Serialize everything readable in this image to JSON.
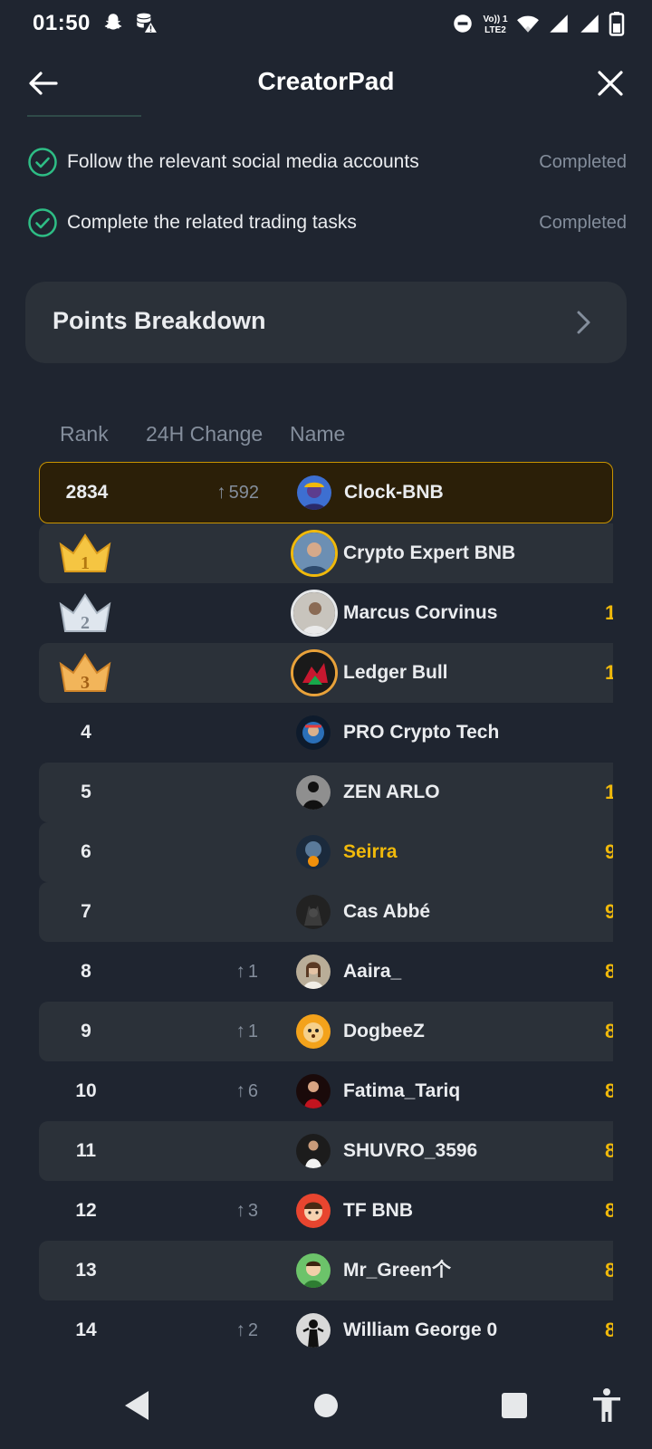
{
  "status_bar": {
    "time": "01:50",
    "icons": [
      "snapchat-icon",
      "storage-warning-icon",
      "do-not-disturb-icon",
      "volte-icon",
      "wifi-icon",
      "signal-icon",
      "signal-icon",
      "battery-icon"
    ],
    "volte_text": "Vo)) 1 LTE2"
  },
  "header": {
    "title": "CreatorPad",
    "back_icon": "back-arrow-icon",
    "close_icon": "close-icon"
  },
  "tasks": [
    {
      "label": "Follow the relevant social media accounts",
      "status": "Completed",
      "icon": "check-circle-icon"
    },
    {
      "label": "Complete the related trading tasks",
      "status": "Completed",
      "icon": "check-circle-icon"
    }
  ],
  "points_breakdown": {
    "title": "Points Breakdown",
    "icon": "chevron-right-icon"
  },
  "leaderboard": {
    "columns": {
      "rank": "Rank",
      "change": "24H Change",
      "name": "Name"
    },
    "rows": [
      {
        "rank": "2834",
        "change": "592",
        "name": "Clock-BNB",
        "points_peek": ""
      },
      {
        "rank": "1",
        "change": "",
        "name": "Crypto Expert BNB",
        "points_peek": ""
      },
      {
        "rank": "2",
        "change": "",
        "name": "Marcus Corvinus",
        "points_peek": "1"
      },
      {
        "rank": "3",
        "change": "",
        "name": "Ledger Bull",
        "points_peek": "1"
      },
      {
        "rank": "4",
        "change": "",
        "name": "PRO Crypto Tech",
        "points_peek": ""
      },
      {
        "rank": "5",
        "change": "",
        "name": "ZEN ARLO",
        "points_peek": "1"
      },
      {
        "rank": "6",
        "change": "",
        "name": "Seirra",
        "points_peek": "9"
      },
      {
        "rank": "7",
        "change": "",
        "name": "Cas Abbé",
        "points_peek": "9"
      },
      {
        "rank": "8",
        "change": "1",
        "name": "Aaira_",
        "points_peek": "8"
      },
      {
        "rank": "9",
        "change": "1",
        "name": "DogbeeZ",
        "points_peek": "8"
      },
      {
        "rank": "10",
        "change": "6",
        "name": "Fatima_Tariq",
        "points_peek": "8"
      },
      {
        "rank": "11",
        "change": "",
        "name": "SHUVRO_3596",
        "points_peek": "8"
      },
      {
        "rank": "12",
        "change": "3",
        "name": "TF BNB",
        "points_peek": "8"
      },
      {
        "rank": "13",
        "change": "",
        "name": "Mr_Green个",
        "points_peek": "8"
      },
      {
        "rank": "14",
        "change": "2",
        "name": "William George 0",
        "points_peek": "8"
      }
    ]
  },
  "nav_bar": {
    "icons": [
      "nav-back-icon",
      "nav-home-icon",
      "nav-recents-icon",
      "accessibility-icon"
    ]
  },
  "colors": {
    "background": "#1f2530",
    "card": "#2b3139",
    "accent_gold": "#f0b90b",
    "success_green": "#2ebd85",
    "muted_text": "#848e9c"
  }
}
